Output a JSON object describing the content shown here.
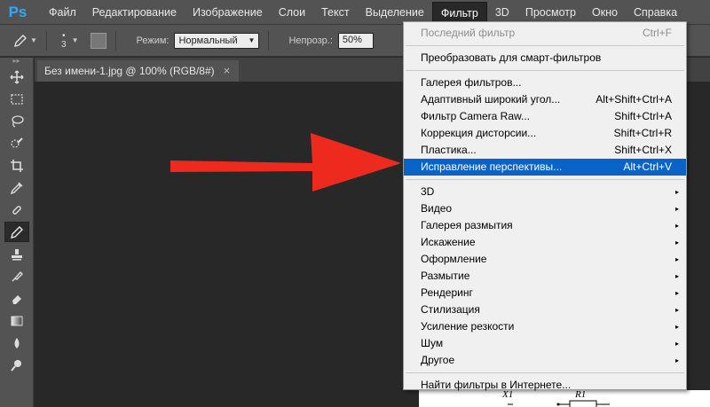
{
  "app": {
    "logo": "Ps"
  },
  "menubar": {
    "items": [
      "Файл",
      "Редактирование",
      "Изображение",
      "Слои",
      "Текст",
      "Выделение",
      "Фильтр",
      "3D",
      "Просмотр",
      "Окно",
      "Справка"
    ],
    "active": "Фильтр"
  },
  "options": {
    "brush_size": "3",
    "mode_label": "Режим:",
    "mode_value": "Нормальный",
    "opacity_label": "Непрозр.:",
    "opacity_value": "50%"
  },
  "toolbar": {
    "tools": [
      "move-tool",
      "marquee-tool",
      "lasso-tool",
      "quick-selection-tool",
      "crop-tool",
      "eyedropper-tool",
      "healing-brush-tool",
      "pencil-tool",
      "clone-stamp-tool",
      "history-brush-tool",
      "eraser-tool",
      "gradient-tool",
      "blur-tool",
      "dodge-tool"
    ],
    "active": "pencil-tool"
  },
  "document_tab": {
    "title": "Без имени-1.jpg @ 100% (RGB/8#)",
    "close": "×"
  },
  "document": {
    "label_x1": "X1",
    "label_r1": "R1"
  },
  "filter_menu": {
    "group1": [
      {
        "label": "Последний фильтр",
        "shortcut": "Ctrl+F",
        "disabled": true
      }
    ],
    "group2": [
      {
        "label": "Преобразовать для смарт-фильтров",
        "shortcut": ""
      }
    ],
    "group3": [
      {
        "label": "Галерея фильтров...",
        "shortcut": ""
      },
      {
        "label": "Адаптивный широкий угол...",
        "shortcut": "Alt+Shift+Ctrl+A"
      },
      {
        "label": "Фильтр Camera Raw...",
        "shortcut": "Shift+Ctrl+A"
      },
      {
        "label": "Коррекция дисторсии...",
        "shortcut": "Shift+Ctrl+R"
      },
      {
        "label": "Пластика...",
        "shortcut": "Shift+Ctrl+X"
      },
      {
        "label": "Исправление перспективы...",
        "shortcut": "Alt+Ctrl+V",
        "highlight": true
      }
    ],
    "group4": [
      {
        "label": "3D"
      },
      {
        "label": "Видео"
      },
      {
        "label": "Галерея размытия"
      },
      {
        "label": "Искажение"
      },
      {
        "label": "Оформление"
      },
      {
        "label": "Размытие"
      },
      {
        "label": "Рендеринг"
      },
      {
        "label": "Стилизация"
      },
      {
        "label": "Усиление резкости"
      },
      {
        "label": "Шум"
      },
      {
        "label": "Другое"
      }
    ],
    "group5": [
      {
        "label": "Найти фильтры в Интернете..."
      }
    ],
    "submenu_arrow": "▸"
  },
  "colors": {
    "highlight": "#0a64c8",
    "arrow": "#ee2a1f",
    "ps_blue": "#31a8ff"
  }
}
